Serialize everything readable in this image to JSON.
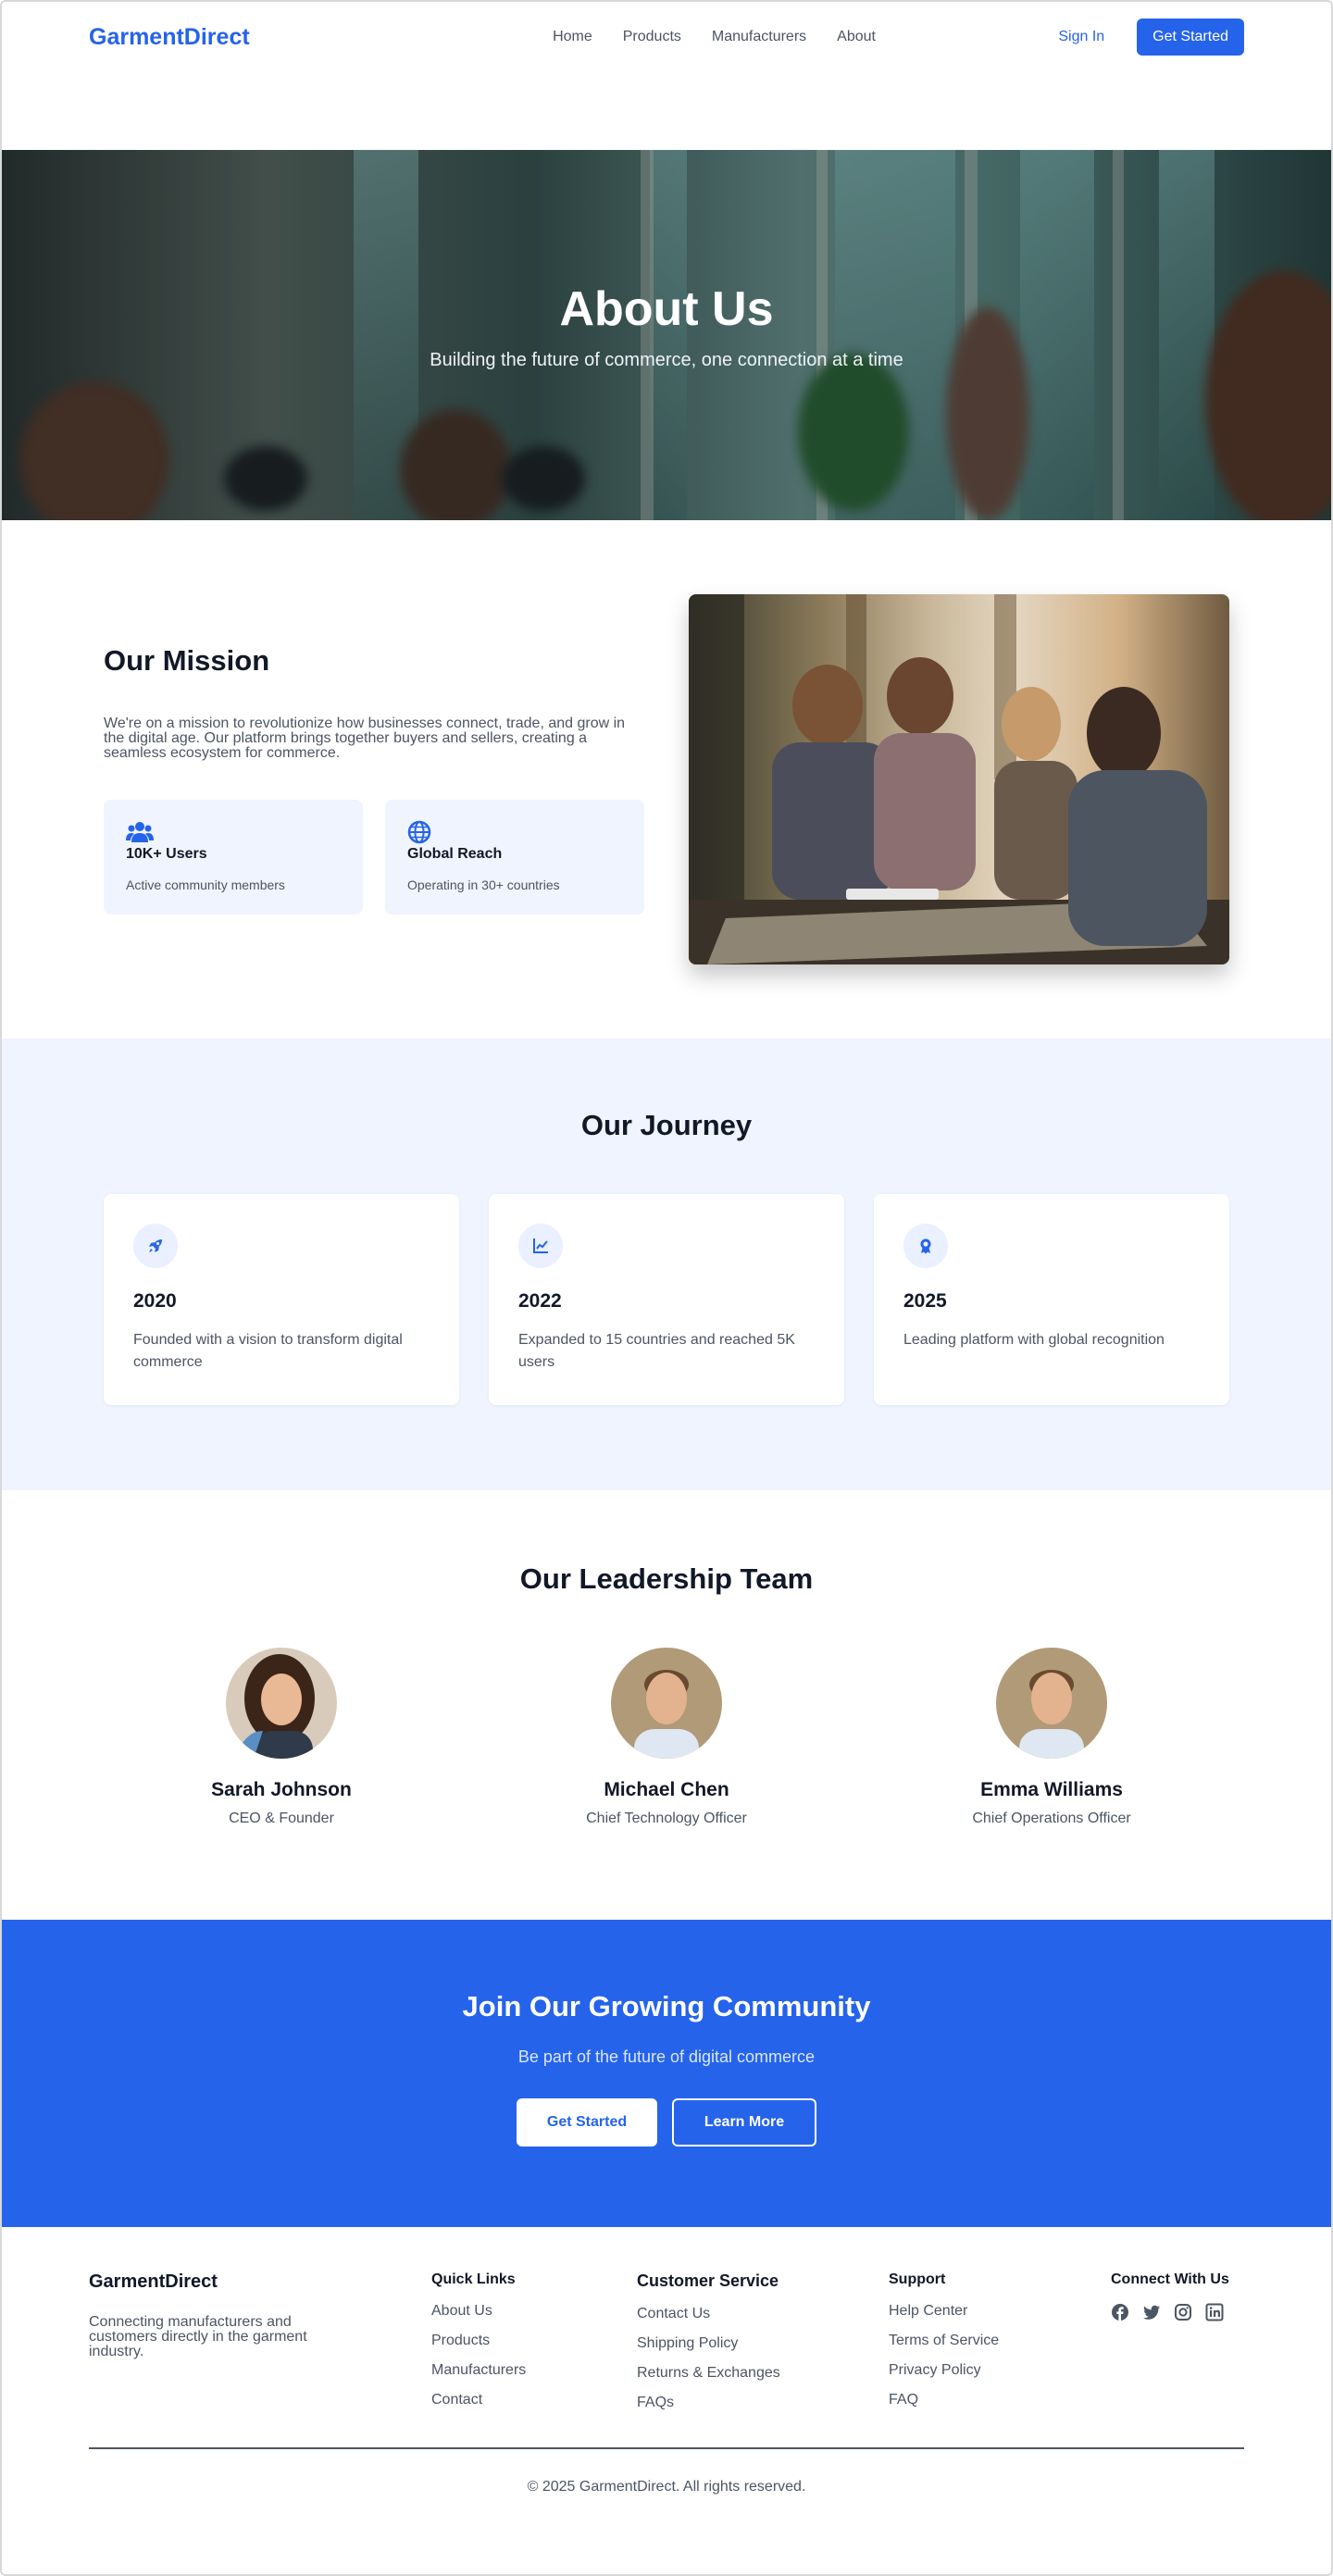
{
  "nav": {
    "logo": "GarmentDirect",
    "links": [
      "Home",
      "Products",
      "Manufacturers",
      "About"
    ],
    "signin": "Sign In",
    "cta": "Get Started"
  },
  "hero": {
    "title": "About Us",
    "subtitle": "Building the future of commerce, one connection at a time"
  },
  "mission": {
    "title": "Our Mission",
    "text": "We're on a mission to revolutionize how businesses connect, trade, and grow in the digital age. Our platform brings together buyers and sellers, creating a seamless ecosystem for commerce.",
    "stats": [
      {
        "icon": "users-icon",
        "title": "10K+ Users",
        "subtitle": "Active community members"
      },
      {
        "icon": "globe-icon",
        "title": "Global Reach",
        "subtitle": "Operating in 30+ countries"
      }
    ]
  },
  "journey": {
    "title": "Our Journey",
    "items": [
      {
        "icon": "rocket-icon",
        "year": "2020",
        "text": "Founded with a vision to transform digital commerce"
      },
      {
        "icon": "chart-line-icon",
        "year": "2022",
        "text": "Expanded to 15 countries and reached 5K users"
      },
      {
        "icon": "award-icon",
        "year": "2025",
        "text": "Leading platform with global recognition"
      }
    ]
  },
  "team": {
    "title": "Our Leadership Team",
    "members": [
      {
        "name": "Sarah Johnson",
        "role": "CEO & Founder"
      },
      {
        "name": "Michael Chen",
        "role": "Chief Technology Officer"
      },
      {
        "name": "Emma Williams",
        "role": "Chief Operations Officer"
      }
    ]
  },
  "cta": {
    "title": "Join Our Growing Community",
    "subtitle": "Be part of the future of digital commerce",
    "primary": "Get Started",
    "secondary": "Learn More"
  },
  "footer": {
    "brand": "GarmentDirect",
    "description": "Connecting manufacturers and customers directly in the garment industry.",
    "quick_links": {
      "title": "Quick Links",
      "items": [
        "About Us",
        "Products",
        "Manufacturers",
        "Contact"
      ]
    },
    "customer_service": {
      "title": "Customer Service",
      "items": [
        "Contact Us",
        "Shipping Policy",
        "Returns & Exchanges",
        "FAQs"
      ]
    },
    "support": {
      "title": "Support",
      "items": [
        "Help Center",
        "Terms of Service",
        "Privacy Policy",
        "FAQ"
      ]
    },
    "connect": {
      "title": "Connect With Us",
      "icons": [
        "facebook-icon",
        "twitter-icon",
        "instagram-icon",
        "linkedin-icon"
      ]
    },
    "copyright": "© 2025 GarmentDirect. All rights reserved."
  },
  "colors": {
    "accent": "#2563eb",
    "light_bg": "#eff4ff",
    "text": "#111827",
    "muted": "#4b5563"
  }
}
